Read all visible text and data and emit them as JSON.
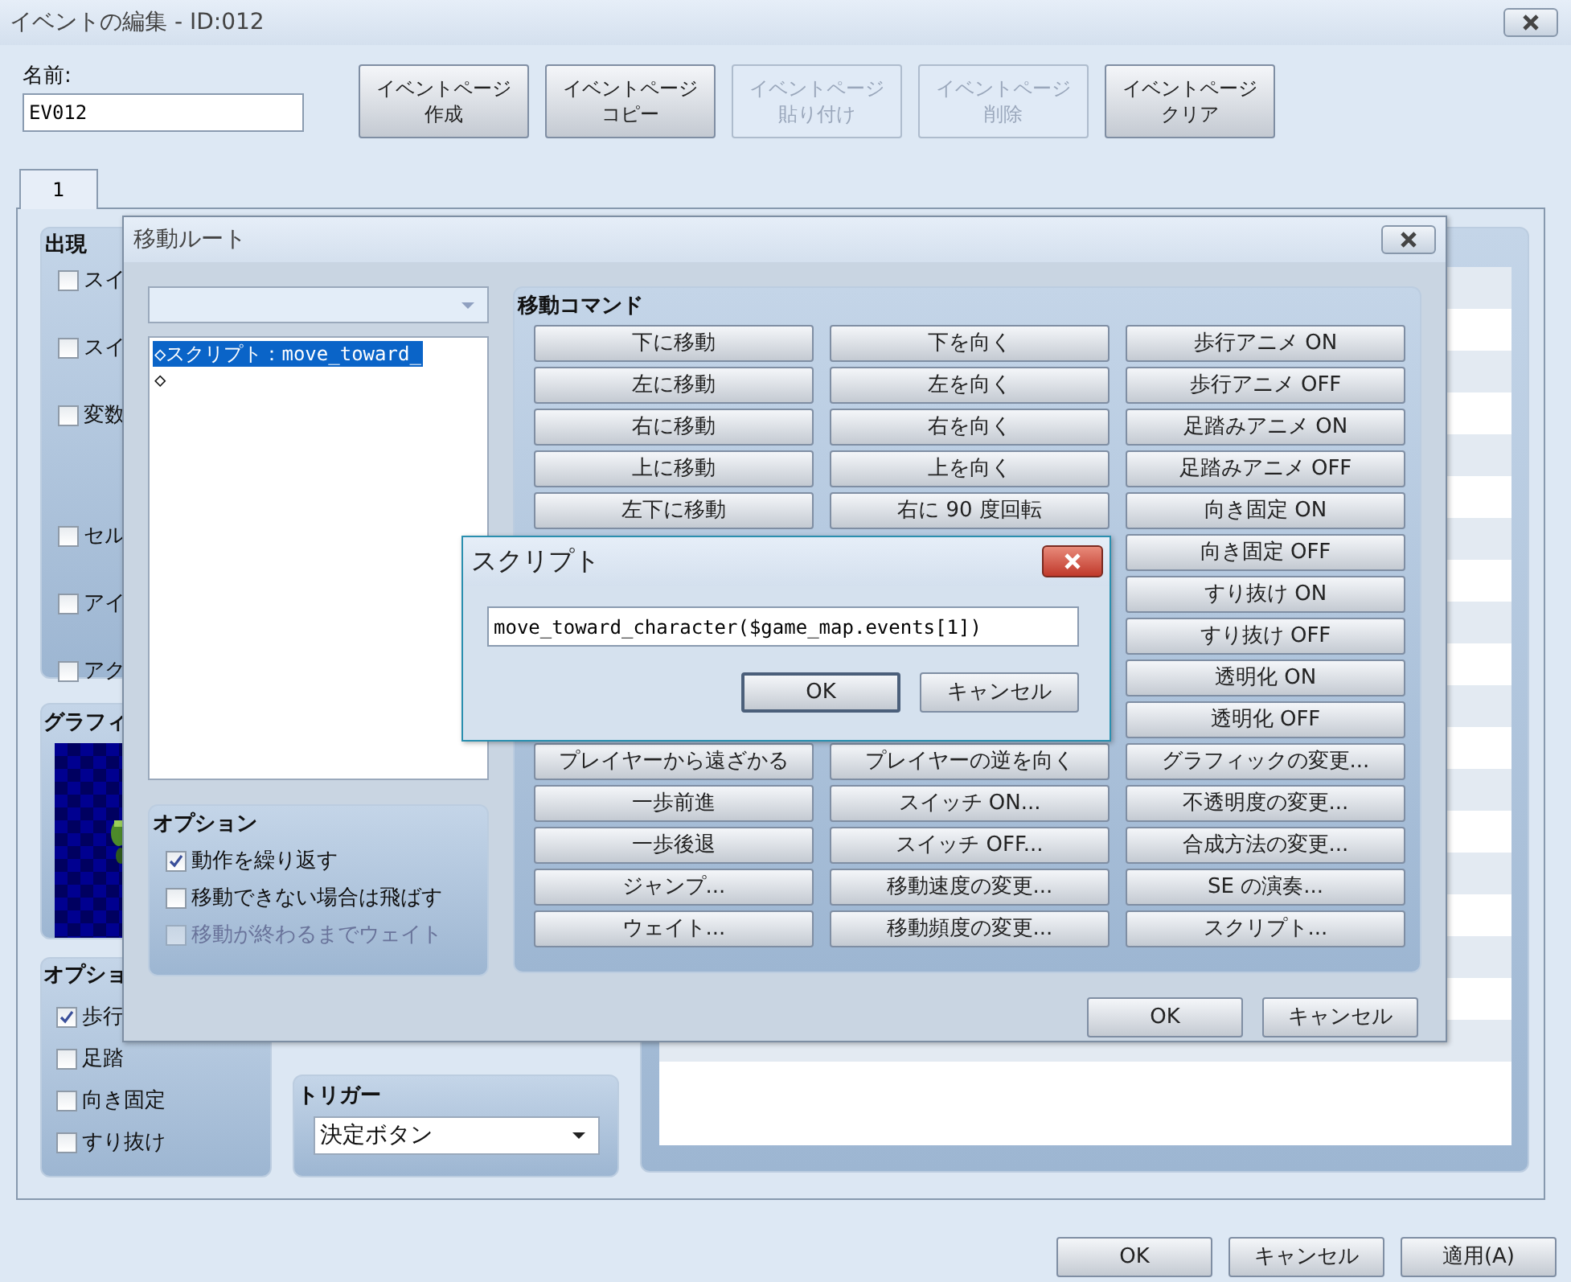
{
  "window": {
    "title": "イベントの編集 - ID:012"
  },
  "name_field": {
    "label": "名前:",
    "value": "EV012"
  },
  "page_buttons": [
    {
      "lines": [
        "イベントページ",
        "作成"
      ],
      "disabled": false
    },
    {
      "lines": [
        "イベントページ",
        "コピー"
      ],
      "disabled": false
    },
    {
      "lines": [
        "イベントページ",
        "貼り付け"
      ],
      "disabled": true
    },
    {
      "lines": [
        "イベントページ",
        "削除"
      ],
      "disabled": true
    },
    {
      "lines": [
        "イベントページ",
        "クリア"
      ],
      "disabled": false
    }
  ],
  "tabs": [
    {
      "label": "1",
      "selected": true
    }
  ],
  "conditions": {
    "title": "出現",
    "items": [
      {
        "label": "スイ",
        "checked": false
      },
      {
        "label": "スイ",
        "checked": false
      },
      {
        "label": "変数",
        "checked": false
      },
      {
        "label": "セル",
        "checked": false
      },
      {
        "label": "アイ",
        "checked": false
      },
      {
        "label": "アク",
        "checked": false
      }
    ]
  },
  "graphic": {
    "title": "グラフィ"
  },
  "options": {
    "title": "オプショ",
    "items": [
      {
        "label": "歩行",
        "checked": true
      },
      {
        "label": "足踏",
        "checked": false
      },
      {
        "label": "向き固定",
        "checked": false
      },
      {
        "label": "すり抜け",
        "checked": false
      }
    ]
  },
  "trigger": {
    "title": "トリガー",
    "value": "決定ボタン"
  },
  "footer_buttons": [
    "OK",
    "キャンセル",
    "適用(A)"
  ],
  "route_dialog": {
    "title": "移動ルート",
    "list": [
      {
        "text": "◇スクリプト：move_toward_",
        "selected": true
      },
      {
        "text": "◇",
        "selected": false
      }
    ],
    "options": {
      "title": "オプション",
      "items": [
        {
          "label": "動作を繰り返す",
          "checked": true,
          "disabled": false
        },
        {
          "label": "移動できない場合は飛ばす",
          "checked": false,
          "disabled": false
        },
        {
          "label": "移動が終わるまでウェイト",
          "checked": false,
          "disabled": true
        }
      ]
    },
    "commands_title": "移動コマンド",
    "command_columns": [
      {
        "groups": [
          [
            "下に移動",
            "左に移動",
            "右に移動",
            "上に移動",
            "左下に移動"
          ],
          [
            "プレイヤーから遠ざかる",
            "一歩前進",
            "一歩後退",
            "ジャンプ...",
            "ウェイト..."
          ]
        ]
      },
      {
        "groups": [
          [
            "下を向く",
            "左を向く",
            "右を向く",
            "上を向く",
            "右に 90 度回転"
          ],
          [
            "プレイヤーの逆を向く",
            "スイッチ ON...",
            "スイッチ OFF...",
            "移動速度の変更...",
            "移動頻度の変更..."
          ]
        ]
      },
      {
        "groups": [
          [
            "歩行アニメ ON",
            "歩行アニメ OFF",
            "足踏みアニメ ON",
            "足踏みアニメ OFF",
            "向き固定 ON",
            "向き固定 OFF",
            "すり抜け ON",
            "すり抜け OFF",
            "透明化 ON",
            "透明化 OFF",
            "グラフィックの変更...",
            "不透明度の変更...",
            "合成方法の変更...",
            "SE の演奏...",
            "スクリプト..."
          ]
        ]
      }
    ],
    "buttons": [
      "OK",
      "キャンセル"
    ]
  },
  "script_dialog": {
    "title": "スクリプト",
    "value": "move_toward_character($game_map.events[1])",
    "buttons": [
      "OK",
      "キャンセル"
    ]
  }
}
